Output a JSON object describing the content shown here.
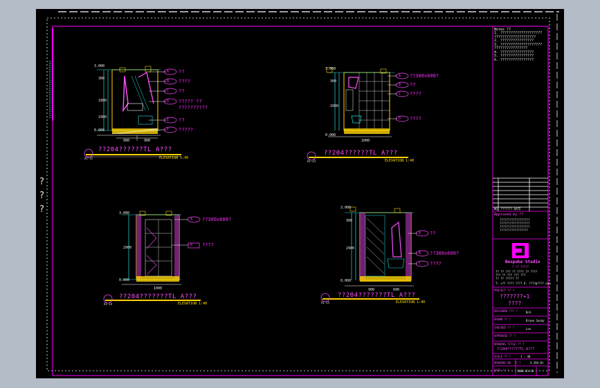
{
  "side_marks": [
    "?",
    "?",
    "?"
  ],
  "left_margin_note": "????????????????????????????",
  "elevations": [
    {
      "title": "??204??????TL  A???",
      "scale": "ELEVATION 1:40",
      "tag": "A1-12",
      "levels": [
        "3.000",
        "0.000"
      ],
      "dims": [
        "300",
        "1800",
        "2900"
      ],
      "bottom_dims": [
        "900",
        "900"
      ],
      "callouts": [
        {
          "tag": "A",
          "text": "??"
        },
        {
          "tag": "B",
          "text": "????"
        },
        {
          "tag": "C",
          "text": "??"
        },
        {
          "tag": "D",
          "text": "????? ??"
        },
        {
          "tag": "",
          "text": "??????????"
        },
        {
          "tag": "E",
          "text": "??"
        },
        {
          "tag": "F",
          "text": "?????"
        }
      ]
    },
    {
      "title": "??204??????TL  A???",
      "scale": "ELEVATION 1:40",
      "tag": "A1-13",
      "levels": [
        "3.000",
        "0.000"
      ],
      "dims": [
        "300",
        "2900"
      ],
      "bottom_dims": [
        "1000"
      ],
      "callouts": [
        {
          "tag": "A",
          "text": "??300x600?"
        },
        {
          "tag": "B",
          "text": "??"
        },
        {
          "tag": "C",
          "text": "????"
        },
        {
          "tag": "D",
          "text": "????"
        }
      ]
    },
    {
      "title": "??204???????TL  A???",
      "scale": "ELEVATION 1:40",
      "tag": "A1-14",
      "levels": [
        "3.000",
        "0.000"
      ],
      "dims": [
        "2900"
      ],
      "bottom_dims": [
        "1000"
      ],
      "callouts": [
        {
          "tag": "A",
          "text": "??300x600?"
        },
        {
          "tag": "B",
          "text": "????"
        }
      ]
    },
    {
      "title": "??204???????TL  A???",
      "scale": "ELEVATION 1:40",
      "tag": "A1-15",
      "levels": [
        "3.000",
        "0.000"
      ],
      "dims": [
        "300",
        "2900"
      ],
      "bottom_dims": [
        "900",
        "600"
      ],
      "callouts": [
        {
          "tag": "A",
          "text": "??"
        },
        {
          "tag": "B",
          "text": "??300x600?"
        },
        {
          "tag": "C",
          "text": "????"
        }
      ]
    }
  ],
  "title_block": {
    "notes_header": "Notes ??",
    "notes": [
      "1. ????????????????????",
      "   ????????????????????",
      "2. ????????????????",
      "3. ????????????????????",
      "   ????????????????",
      "4. ????????????????",
      "5. ????????????????",
      "6. ????????????????"
    ],
    "revision_header": "NO.   ???????   DATE",
    "approval_label": "Approved by ??",
    "approval_lines": [
      "??????????????????",
      "??????????????????",
      "??????????????????",
      "?????????????????"
    ],
    "company_name": "Bespoke Studio",
    "company_sub": "? ?? ?????",
    "company_address": [
      "?? ?? ??? ?? ???? ?? ????",
      "??? ?? ??? ??? ???",
      "?? ?? ????? ??"
    ],
    "company_contact": "T: +?? ???? ????  E: ????@????.com",
    "project_label": "PROJECT ?? ?",
    "project_name": "???????+1",
    "project_sub": "????",
    "fields": [
      {
        "label": "DESIGNED ??? ?",
        "value": "N/A"
      },
      {
        "label": "DRAWN ?? ?",
        "value": "Brown  Sandy"
      },
      {
        "label": "CHECKED ?? ?",
        "value": "Lee"
      },
      {
        "label": "APPROVED ?? ?",
        "value": ""
      },
      {
        "label": "DRAWING TITLE ?? ?",
        "value": ""
      },
      {
        "label": "",
        "value": "??204??????TL  A???"
      },
      {
        "label": "SCALE ?? ?",
        "value": "1 : 40"
      },
      {
        "label": "DRAWING NO. ?? ?",
        "value": "A-204-01"
      },
      {
        "label": "DATE ?? ?",
        "value": "2008.03.26"
      }
    ]
  }
}
